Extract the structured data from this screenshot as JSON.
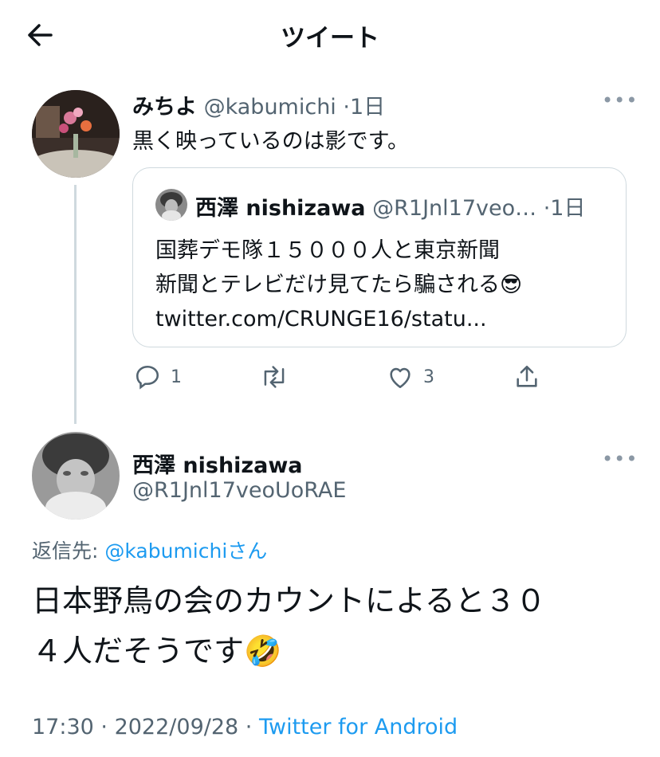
{
  "header": {
    "title": "ツイート"
  },
  "parent_tweet": {
    "display_name": "みちよ",
    "handle": "@kabumichi",
    "time": "1日",
    "text": "黒く映っているのは影です。",
    "quoted": {
      "display_name": "西澤 nishizawa",
      "handle": "@R1Jnl17veo…",
      "time": "1日",
      "line1": "国葬デモ隊１５０００人と東京新聞",
      "line2": "新聞とテレビだけ見てたら騙される",
      "line2_emoji": "😎",
      "link": "twitter.com/CRUNGE16/statu..."
    },
    "actions": {
      "reply_count": "1",
      "retweet_count": "",
      "like_count": "3"
    }
  },
  "main_tweet": {
    "display_name": "西澤 nishizawa",
    "handle": "@R1Jnl17veoUoRAE",
    "reply_to_prefix": "返信先: ",
    "reply_to_handle": "@kabumichi",
    "reply_to_suffix": "さん",
    "text_line1": "日本野鳥の会のカウントによると３０",
    "text_line2": "４人だそうです",
    "text_emoji": "🤣",
    "time": "17:30",
    "date": "2022/09/28",
    "source": "Twitter for Android"
  },
  "icons": [
    "back-arrow-icon",
    "more-icon",
    "reply-icon",
    "retweet-icon",
    "like-icon",
    "share-icon"
  ]
}
